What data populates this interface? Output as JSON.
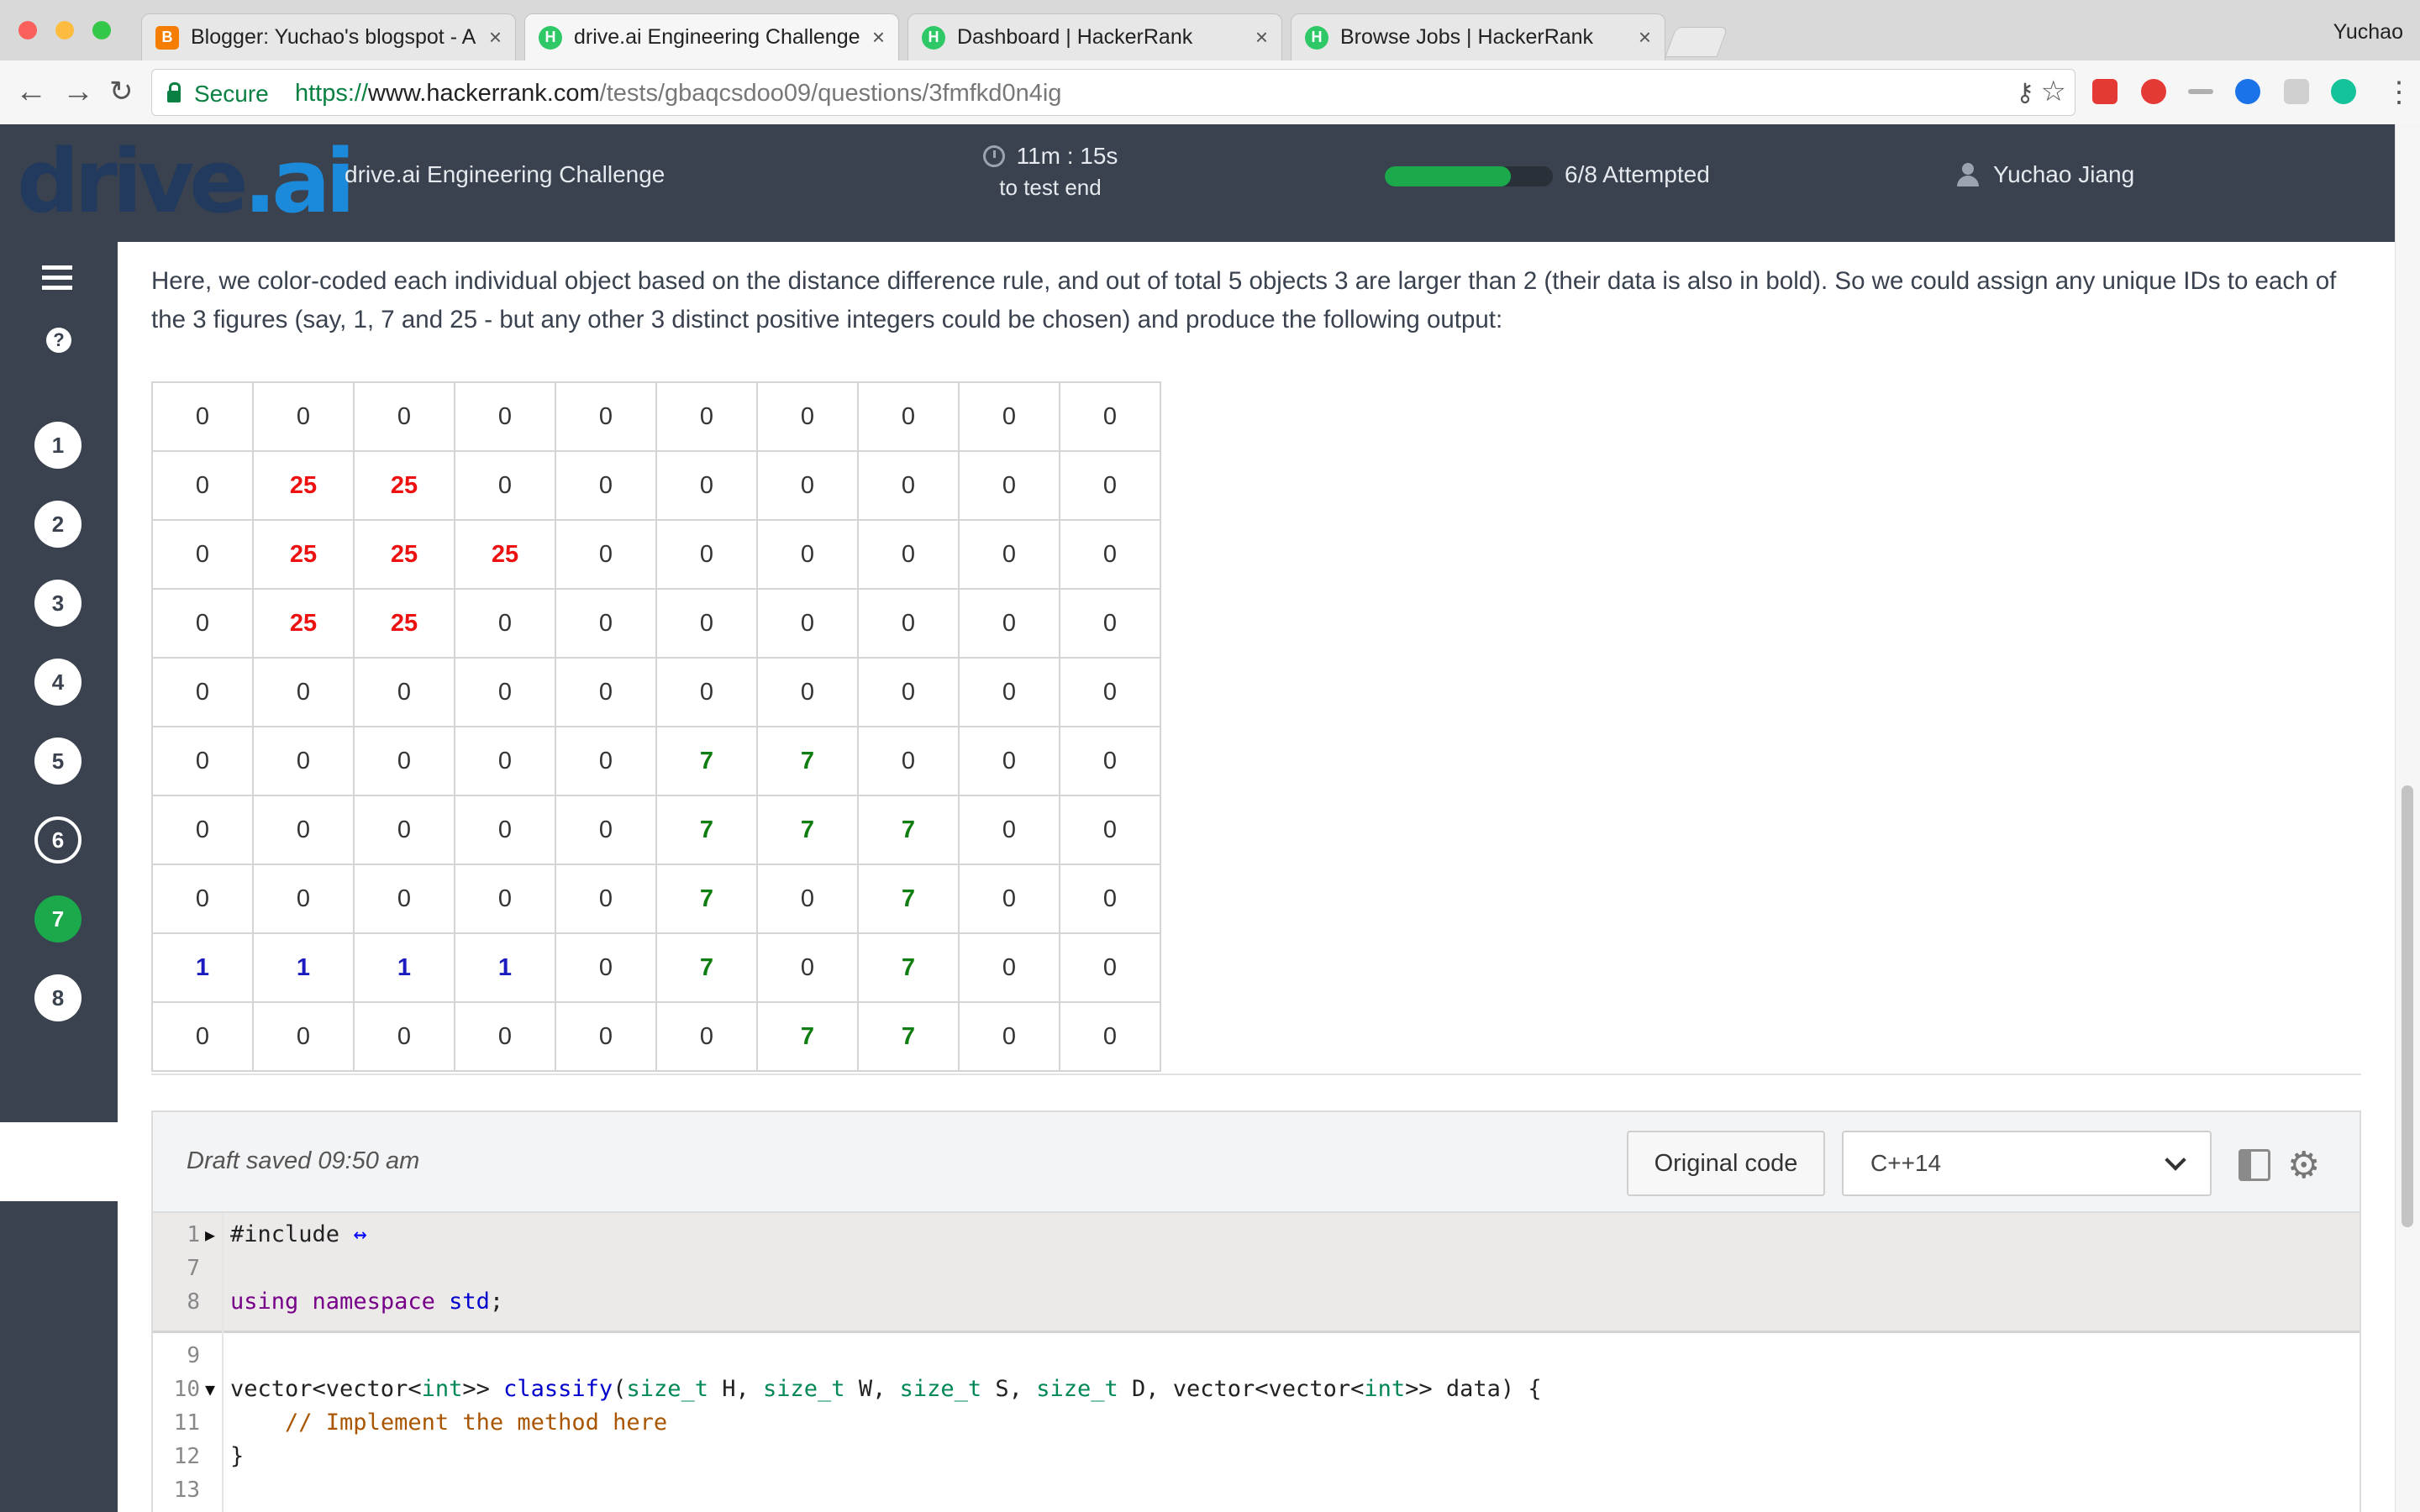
{
  "browser": {
    "profile": "Yuchao",
    "tabs": [
      {
        "title": "Blogger: Yuchao's blogspot - A",
        "favicon": "blogger-icon",
        "favicon_color": "#f57d00",
        "favicon_glyph": "B"
      },
      {
        "title": "drive.ai Engineering Challenge",
        "favicon": "hackerrank-icon",
        "favicon_color": "#2ec866",
        "favicon_glyph": "H",
        "active": true
      },
      {
        "title": "Dashboard | HackerRank",
        "favicon": "hackerrank-icon",
        "favicon_color": "#2ec866",
        "favicon_glyph": "H"
      },
      {
        "title": "Browse Jobs | HackerRank",
        "favicon": "hackerrank-icon",
        "favicon_color": "#2ec866",
        "favicon_glyph": "H"
      }
    ],
    "close_glyph": "×",
    "security_label": "Secure",
    "url_scheme": "https://",
    "url_host": "www.hackerrank.com",
    "url_path": "/tests/gbaqcsdoo09/questions/3fmfkd0n4ig"
  },
  "header": {
    "logo_text": "drive",
    "logo_dot": ".ai",
    "challenge_title": "drive.ai Engineering Challenge",
    "timer": "11m : 15s",
    "timer_sub": "to test end",
    "progress_fraction": 0.75,
    "attempted": "6/8 Attempted",
    "user_name": "Yuchao Jiang",
    "brand_color": "#39424e",
    "accent_color": "#1ba94c"
  },
  "sidebar": {
    "help_glyph": "?",
    "questions": [
      "1",
      "2",
      "3",
      "4",
      "5",
      "6",
      "7",
      "8"
    ],
    "current": "7",
    "attempted_outlined": "6"
  },
  "problem": {
    "text": "Here, we color-coded each individual object based on the distance difference rule, and out of total 5 objects 3 are larger than 2 (their data is also in bold). So we could assign any unique IDs to each of the 3 figures (say, 1, 7 and 25 - but any other 3 distinct positive integers could be chosen) and produce the following output:",
    "grid": [
      [
        "0",
        "0",
        "0",
        "0",
        "0",
        "0",
        "0",
        "0",
        "0",
        "0"
      ],
      [
        "0",
        "25",
        "25",
        "0",
        "0",
        "0",
        "0",
        "0",
        "0",
        "0"
      ],
      [
        "0",
        "25",
        "25",
        "25",
        "0",
        "0",
        "0",
        "0",
        "0",
        "0"
      ],
      [
        "0",
        "25",
        "25",
        "0",
        "0",
        "0",
        "0",
        "0",
        "0",
        "0"
      ],
      [
        "0",
        "0",
        "0",
        "0",
        "0",
        "0",
        "0",
        "0",
        "0",
        "0"
      ],
      [
        "0",
        "0",
        "0",
        "0",
        "0",
        "7",
        "7",
        "0",
        "0",
        "0"
      ],
      [
        "0",
        "0",
        "0",
        "0",
        "0",
        "7",
        "7",
        "7",
        "0",
        "0"
      ],
      [
        "0",
        "0",
        "0",
        "0",
        "0",
        "7",
        "0",
        "7",
        "0",
        "0"
      ],
      [
        "1",
        "1",
        "1",
        "1",
        "0",
        "7",
        "0",
        "7",
        "0",
        "0"
      ],
      [
        "0",
        "0",
        "0",
        "0",
        "0",
        "0",
        "7",
        "7",
        "0",
        "0"
      ]
    ],
    "value_colors": {
      "25": "red",
      "7": "green",
      "1": "blue"
    }
  },
  "editor": {
    "draft_status": "Draft saved 09:50 am",
    "original_code_label": "Original code",
    "language": "C++14",
    "lines": [
      {
        "num": "1",
        "fold": "▶",
        "tokens": [
          [
            "#include ",
            ""
          ],
          [
            "↔",
            "link"
          ]
        ]
      },
      {
        "num": "7",
        "tokens": []
      },
      {
        "num": "8",
        "tokens": [
          [
            "using",
            "kw"
          ],
          [
            " ",
            ""
          ],
          [
            "namespace",
            "kw"
          ],
          [
            " ",
            ""
          ],
          [
            "std",
            "fn"
          ],
          [
            ";",
            ""
          ]
        ]
      },
      {
        "num": "9",
        "tokens": []
      },
      {
        "num": "10",
        "fold": "▼",
        "tokens": [
          [
            "vector<vector<",
            ""
          ],
          [
            "int",
            "ty"
          ],
          [
            ">> ",
            ""
          ],
          [
            "classify",
            "fn"
          ],
          [
            "(",
            ""
          ],
          [
            "size_t",
            "ty"
          ],
          [
            " H, ",
            ""
          ],
          [
            "size_t",
            "ty"
          ],
          [
            " W, ",
            ""
          ],
          [
            "size_t",
            "ty"
          ],
          [
            " S, ",
            ""
          ],
          [
            "size_t",
            "ty"
          ],
          [
            " D, vector<vector<",
            ""
          ],
          [
            "int",
            "ty"
          ],
          [
            ">> data) {",
            ""
          ]
        ]
      },
      {
        "num": "11",
        "tokens": [
          [
            "    ",
            ""
          ],
          [
            "// Implement the method here",
            "cm"
          ]
        ]
      },
      {
        "num": "12",
        "tokens": [
          [
            "}",
            ""
          ]
        ]
      },
      {
        "num": "13",
        "tokens": []
      }
    ]
  }
}
